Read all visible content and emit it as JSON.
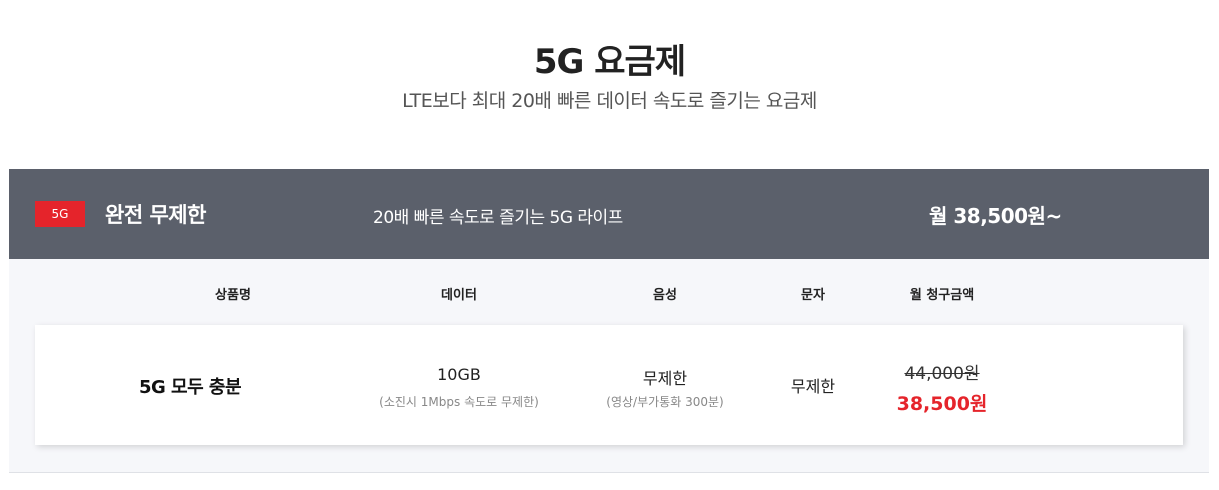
{
  "page": {
    "title": "5G 요금제",
    "subtitle": "LTE보다 최대 20배 빠른 데이터 속도로 즐기는 요금제"
  },
  "plan_group": {
    "badge": "5G",
    "name": "완전 무제한",
    "description": "20배 빠른 속도로 즐기는 5G 라이프",
    "price": "월 38,500원~"
  },
  "columns": {
    "name": "상품명",
    "data": "데이터",
    "voice": "음성",
    "sms": "문자",
    "bill": "월 청구금액"
  },
  "plans": [
    {
      "name": "5G 모두 충분",
      "data": "10GB",
      "data_note": "(소진시 1Mbps 속도로 무제한)",
      "voice": "무제한",
      "voice_note": "(영상/부가통화 300분)",
      "sms": "무제한",
      "original_price": "44,000원",
      "sale_price": "38,500원"
    }
  ],
  "colors": {
    "header_bg": "#5b606b",
    "accent_red": "#e5242b",
    "section_bg": "#f6f7fa"
  }
}
